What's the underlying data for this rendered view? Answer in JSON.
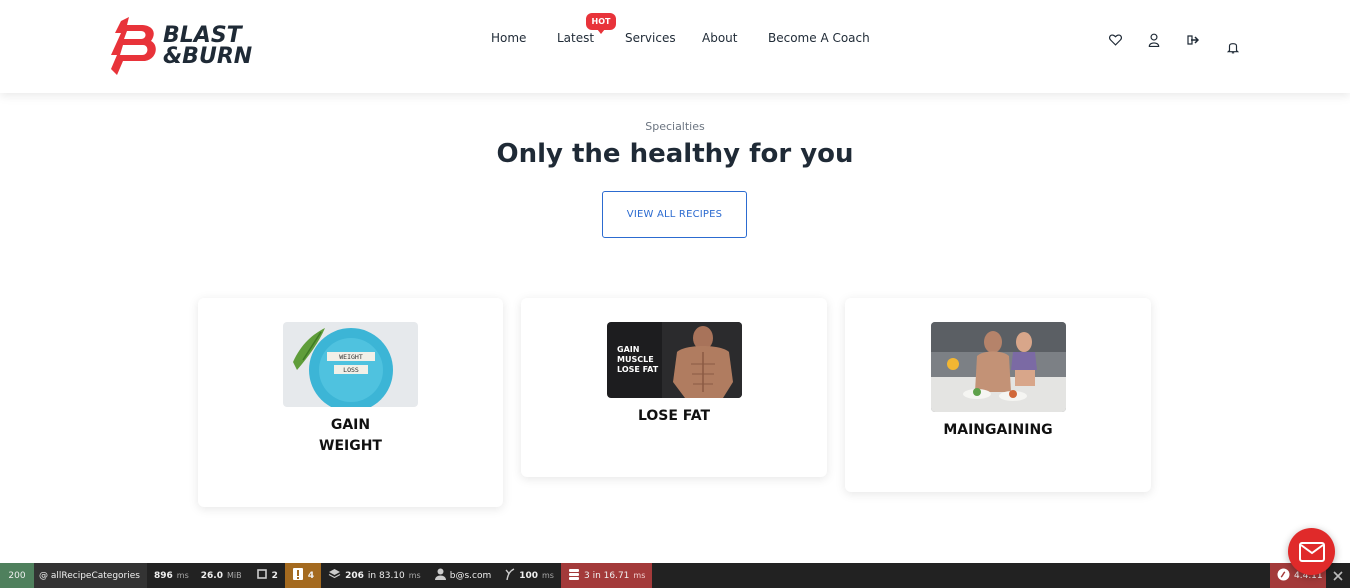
{
  "header": {
    "logo": {
      "line1": "BLAST",
      "line2": "&BURN"
    },
    "nav": [
      {
        "label": "Home"
      },
      {
        "label": "Latest",
        "badge": "HOT"
      },
      {
        "label": "Services"
      },
      {
        "label": "About"
      },
      {
        "label": "Become A Coach"
      }
    ],
    "icons": [
      "heart-icon",
      "user-icon",
      "logout-icon",
      "bell-icon"
    ]
  },
  "hero": {
    "eyebrow": "Specialties",
    "title": "Only the healthy for you",
    "button_label": "VIEW ALL RECIPES"
  },
  "cards": [
    {
      "label_line1": "GAIN",
      "label_line2": "WEIGHT"
    },
    {
      "label_line1": "LOSE FAT",
      "label_line2": "",
      "image_text": [
        "GAIN",
        "MUSCLE",
        "LOSE FAT"
      ]
    },
    {
      "label_line1": "MAINGAINING",
      "label_line2": ""
    }
  ],
  "plate_text": [
    "WEIGHT",
    "LOSS"
  ],
  "toolbar": {
    "status": "200",
    "route": "@ allRecipeCategories",
    "time_value": "896",
    "time_unit": "ms",
    "memory_value": "26.0",
    "memory_unit": "MiB",
    "forms_count": "2",
    "warnings_count": "4",
    "cache_value": "206",
    "cache_text": "in 83.10",
    "cache_unit": "ms",
    "user": "b@s.com",
    "twig_value": "100",
    "twig_unit": "ms",
    "db_value": "3 in 16.71",
    "db_unit": "ms",
    "symfony_version": "4.4.11"
  },
  "colors": {
    "brand_red": "#e8333a",
    "link_blue": "#2c6bd0",
    "dark_text": "#1f2a36",
    "toolbar_bg": "#222222",
    "status_green": "#4f805d",
    "warning_amber": "#a46a1f",
    "db_red": "#a33a3a"
  }
}
